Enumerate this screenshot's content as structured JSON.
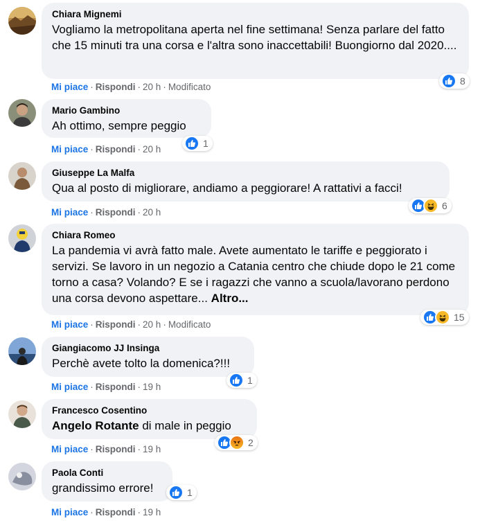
{
  "actions": {
    "like_label": "Mi piace",
    "reply_label": "Rispondi",
    "separator": "·"
  },
  "colors": {
    "like_blue": "#1b74e4",
    "bubble_bg": "#f0f2f5",
    "meta_gray": "#65676b"
  },
  "comments": [
    {
      "author": "Chiara Mignemi",
      "text": "Vogliamo la metropolitana aperta nel fine settimana! Senza parlare del fatto che 15 minuti tra una corsa e l'altra sono inaccettabili! Buongiorno dal 2020....",
      "time": "20 h",
      "edited": "Modificato",
      "reactions": [
        "like-icon"
      ],
      "reaction_count": "8"
    },
    {
      "author": "Mario Gambino",
      "text": "Ah ottimo, sempre peggio",
      "time": "20 h",
      "reactions": [
        "like-icon"
      ],
      "reaction_count": "1"
    },
    {
      "author": "Giuseppe La Malfa",
      "text": "Qua al posto di migliorare, andiamo a peggiorare! A rattativi a facci!",
      "time": "20 h",
      "reactions": [
        "like-icon",
        "haha-icon"
      ],
      "reaction_count": "6"
    },
    {
      "author": "Chiara Romeo",
      "text": "La pandemia vi avrà fatto male. Avete aumentato le tariffe e peggiorato i servizi. Se lavoro in un negozio a Catania centro che chiude dopo le 21 come torno a casa? Volando? E se i ragazzi che vanno a scuola/lavorano perdono una corsa devono aspettare...",
      "more": "Altro...",
      "time": "20 h",
      "edited": "Modificato",
      "reactions": [
        "like-icon",
        "haha-icon"
      ],
      "reaction_count": "15"
    },
    {
      "author": "Giangiacomo JJ Insinga",
      "text": "Perchè avete tolto la domenica?!!!",
      "time": "19 h",
      "reactions": [
        "like-icon"
      ],
      "reaction_count": "1"
    },
    {
      "author": "Francesco Cosentino",
      "mention": "Angelo Rotante",
      "text": "di male in peggio",
      "time": "19 h",
      "reactions": [
        "like-icon",
        "angry-icon"
      ],
      "reaction_count": "2"
    },
    {
      "author": "Paola Conti",
      "text": "grandissimo errore!",
      "time": "19 h",
      "reactions": [
        "like-icon"
      ],
      "reaction_count": "1"
    }
  ]
}
